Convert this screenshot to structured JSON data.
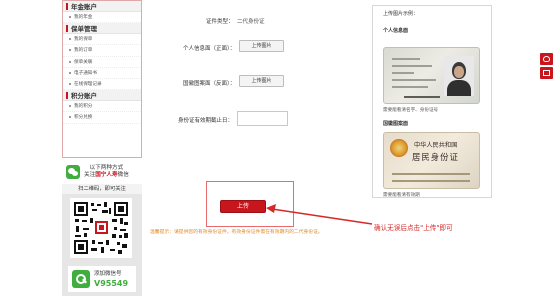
{
  "sidebar": {
    "sections": [
      {
        "title": "年金账户",
        "items": [
          {
            "label": "我的年金"
          }
        ]
      },
      {
        "title": "保单管理",
        "items": [
          {
            "label": "我的保单"
          },
          {
            "label": "我的订单"
          },
          {
            "label": "保单关联"
          },
          {
            "label": "电子通知书"
          },
          {
            "label": "在线保理记录"
          }
        ]
      },
      {
        "title": "积分账户",
        "items": [
          {
            "label": "我的积分"
          },
          {
            "label": "积分兑换"
          }
        ]
      }
    ]
  },
  "promo": {
    "line1": "以下两种方式",
    "line2_prefix": "关注",
    "line2_brand": "国宁人寿",
    "line2_suffix": "微信",
    "qr_title": "扫二维码，即可关注",
    "hotline_label": "添加微信号",
    "hotline_number": "V95549"
  },
  "form": {
    "cert_type_label": "证件类型：",
    "cert_type_value": "二代身份证",
    "front_label": "个人信息面（正面）：",
    "front_button": "上传图片",
    "back_label": "国徽图案面（反面）：",
    "back_button": "上传图片",
    "expiry_label": "身份证有效期截止日：",
    "expiry_value": ""
  },
  "submit": {
    "button_label": "上传",
    "tip": "温馨提示：请提供您的有效身份证件，有效身份证件需在有效期内的二代身份证。",
    "callout": "确认无误后点击\"上传\"即可"
  },
  "example": {
    "title": "上传图片示例：",
    "front_title": "个人信息面",
    "front_note": "需要能看清名字、身份证号",
    "back_title": "国徽图案面",
    "back_note": "需要能看清有效期",
    "card_back_line1": "中华人民共和国",
    "card_back_line2": "居民身份证"
  },
  "floating": {
    "icons": [
      "qq-icon",
      "mail-icon"
    ]
  },
  "colors": {
    "brand_red": "#c8161d",
    "callout_red": "#d42a2a",
    "tip_orange": "#e08a2a",
    "wechat_green": "#3fae3f"
  }
}
